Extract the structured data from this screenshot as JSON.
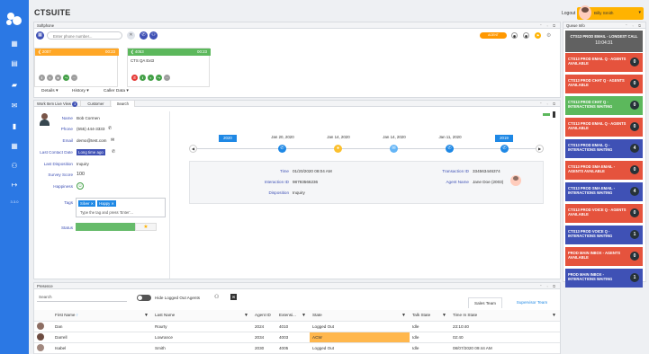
{
  "app": {
    "title": "CTSUITE"
  },
  "leftnav": {
    "items": [
      {
        "name": "dashboard-icon",
        "glyph": "▦"
      },
      {
        "name": "contacts-icon",
        "glyph": "▤"
      },
      {
        "name": "chat-icon",
        "glyph": "▰"
      },
      {
        "name": "email-icon",
        "glyph": "✉"
      },
      {
        "name": "document-icon",
        "glyph": "▮"
      },
      {
        "name": "grid-icon",
        "glyph": "▦"
      },
      {
        "name": "users-icon",
        "glyph": "⚇"
      },
      {
        "name": "logout-icon",
        "glyph": "↦"
      }
    ],
    "version": "3.3.0"
  },
  "topright": {
    "logout_label": "Logout",
    "user_name": "Billy Smith"
  },
  "softphone": {
    "title": "Softphone",
    "phone_placeholder": "Enter phone number...",
    "status_badge": "AGENT AVAILABLE",
    "calls": [
      {
        "number": "2007",
        "time": "00:23",
        "status": "orange"
      },
      {
        "number": "4053",
        "time": "00:23",
        "status": "green",
        "name": "CTS QA Ext3"
      }
    ],
    "menus": [
      "Details",
      "History",
      "Caller Data"
    ]
  },
  "workitem": {
    "tab_live": "Work Item Live View",
    "tab_live_count": "3",
    "tab_customer": "Customer",
    "tab_search": "Search",
    "fields": {
      "name_label": "Name",
      "name": "Bob Cormen",
      "phone_label": "Phone",
      "phone": "(555) 444-3333",
      "email_label": "Email",
      "email": "demo@test.com",
      "last_contact_label": "Last Contact Date",
      "last_contact": "Long time ago",
      "last_disposition_label": "Last Disposition",
      "last_disposition": "Inquiry",
      "survey_label": "Survey Score",
      "survey": "100",
      "happiness_label": "Happiness",
      "tags_label": "Tags",
      "tags": [
        "Silver",
        "Happy"
      ],
      "tags_placeholder": "Type the tag and press 'Enter'...",
      "status_label": "Status"
    },
    "timeline": {
      "years": [
        "2020",
        "2019"
      ],
      "dates": [
        "Jan 20, 2020",
        "Jan 14, 2020",
        "Jan 14, 2020",
        "Jan 11, 2020"
      ],
      "details": {
        "time_label": "Time",
        "time": "01/20/2020 08:04 AM",
        "interaction_label": "Interaction ID",
        "interaction": "98793566236",
        "disposition_label": "Disposition",
        "disposition": "Inquiry",
        "transaction_label": "Transaction ID",
        "transaction": "334563446374",
        "agent_label": "Agent Name",
        "agent": "Jane Doe (2003)"
      }
    }
  },
  "queue": {
    "title": "Queue Info",
    "longest": {
      "label": "CTS13 PROD EMAIL - LONGEST CALL",
      "time": "10:04:31"
    },
    "items": [
      {
        "label": "CTS13 PROD EMAIL Q - AGENTS AVAILABLE",
        "count": "0",
        "color": "#e5533d"
      },
      {
        "label": "CTS13 PROD CHAT Q - AGENTS AVAILABLE",
        "count": "0",
        "color": "#e5533d"
      },
      {
        "label": "CTS13 PROD CHAT Q - INTERACTIONS WAITING",
        "count": "0",
        "color": "#5cb85c"
      },
      {
        "label": "CTS13 PROD EMAIL Q - AGENTS AVAILABLE",
        "count": "0",
        "color": "#e5533d"
      },
      {
        "label": "CTS13 PROD EMAIL Q - INTERACTIONS WAITING",
        "count": "4",
        "color": "#3f51b5"
      },
      {
        "label": "CTS13 PROD SMA EMAIL - AGENTS AVAILABLE",
        "count": "0",
        "color": "#e5533d"
      },
      {
        "label": "CTS13 PROD SMA EMAIL - INTERACTIONS WAITING",
        "count": "4",
        "color": "#3f51b5"
      },
      {
        "label": "CTS13 PROD VOICE Q - AGENTS AVAILABLE",
        "count": "0",
        "color": "#e5533d"
      },
      {
        "label": "CTS13 PROD VOICE Q - INTERACTIONS WAITING",
        "count": "1",
        "color": "#3f51b5"
      },
      {
        "label": "PROD MAIN INBOX - AGENTS AVAILABLE",
        "count": "0",
        "color": "#e5533d"
      },
      {
        "label": "PROD MAIN INBOX - INTERACTIONS WAITING",
        "count": "1",
        "color": "#3f51b5"
      }
    ]
  },
  "presence": {
    "title": "Presence",
    "search_placeholder": "Search",
    "hide_logged_out": "Hide Logged Out Agents",
    "tabs": [
      "Sales Team",
      "Supervisor Team"
    ],
    "columns": [
      "First Name",
      "Last Name",
      "Agent ID",
      "Extensi...",
      "State",
      "Talk State",
      "Time In State"
    ],
    "rows": [
      [
        "Dan",
        "Rourty",
        "2024",
        "4010",
        "Logged Out",
        "Idle",
        "23:10:40"
      ],
      [
        "Darrell",
        "Lowrance",
        "2034",
        "4003",
        "ACW",
        "Idle",
        "02:40"
      ],
      [
        "Isabel",
        "Smith",
        "2030",
        "4005",
        "Logged Out",
        "Idle",
        "08/07/2020 09:44 AM"
      ]
    ]
  },
  "colors": {
    "accent": "#2b78e4",
    "acw": "#ffb74d"
  }
}
